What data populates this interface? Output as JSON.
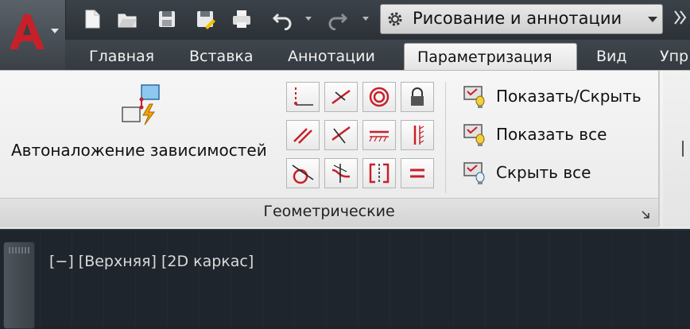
{
  "quick_access": {
    "icons": [
      "new-icon",
      "open-icon",
      "save-icon",
      "save-as-icon",
      "plot-icon",
      "undo-icon",
      "redo-icon"
    ]
  },
  "workspace": {
    "label": "Рисование и аннотации"
  },
  "tabs": [
    {
      "label": "Главная"
    },
    {
      "label": "Вставка"
    },
    {
      "label": "Аннотации"
    },
    {
      "label": "Параметризация",
      "active": true
    },
    {
      "label": "Вид"
    },
    {
      "label": "Упр"
    }
  ],
  "ribbon": {
    "panel_title": "Геометрические",
    "autoconstrain": {
      "label": "Автоналожение зависимостей"
    },
    "geometric_buttons": [
      "coincident-icon",
      "perpendicular-icon",
      "concentric-icon",
      "fix-icon",
      "parallel-icon",
      "tangent-icon",
      "horizontal-icon",
      "vertical-icon",
      "smooth-icon",
      "collinear-icon",
      "symmetric-icon",
      "equal-icon"
    ],
    "show_hide": {
      "show_hide_label": "Показать/Скрыть",
      "show_all_label": "Показать все",
      "hide_all_label": "Скрыть все"
    }
  },
  "viewport": {
    "controls_label": "[−] [Верхняя] [2D каркас]"
  },
  "colors": {
    "accent_red": "#c8202a",
    "ribbon_bg": "#f1f1f1",
    "titlebar_bg": "#343a40"
  }
}
